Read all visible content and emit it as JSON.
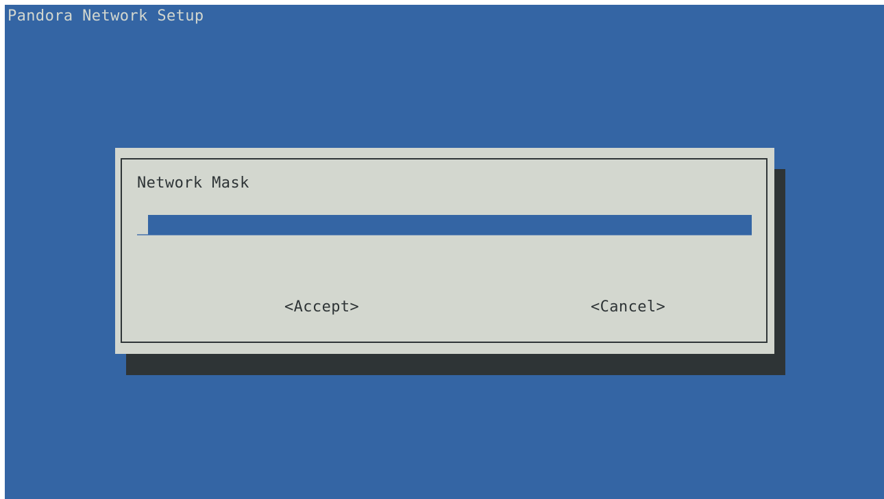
{
  "app": {
    "title": "Pandora Network Setup"
  },
  "dialog": {
    "label": "Network Mask",
    "input_value": "",
    "accept_label": "<Accept>",
    "cancel_label": "<Cancel>"
  },
  "colors": {
    "background": "#3465a4",
    "dialog": "#d3d7cf",
    "shadow": "#2e3436",
    "text": "#2e3436",
    "title_text": "#d3d7cf"
  }
}
